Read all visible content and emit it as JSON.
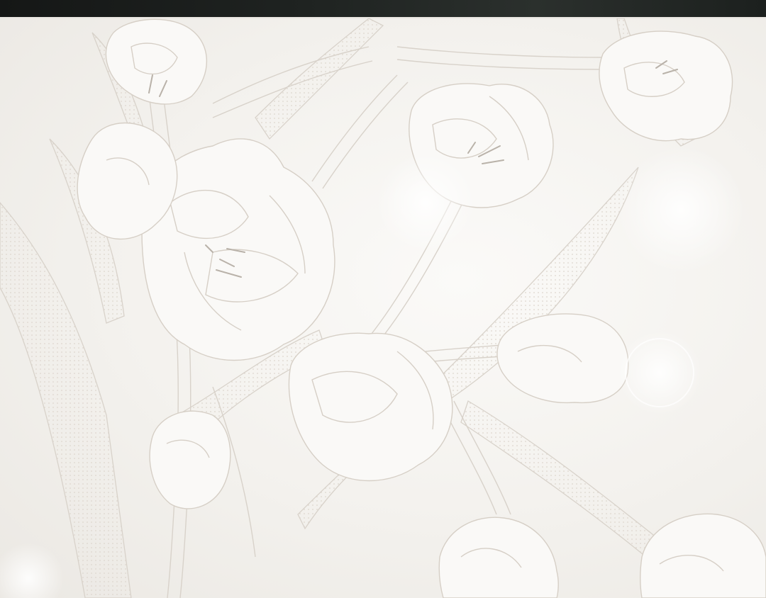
{
  "palette": {
    "band": "#1c201e",
    "paper": "#f3f1ee",
    "line": "#d8d2ca",
    "stamen": "#b9b2a9",
    "dots": "#ddd6cd"
  },
  "illustration": {
    "subject": "tulip-lineart-illustration",
    "icons": [
      "tulip-flower-icon",
      "leaf-icon",
      "stem-icon",
      "sparkle-glow-icon"
    ]
  }
}
